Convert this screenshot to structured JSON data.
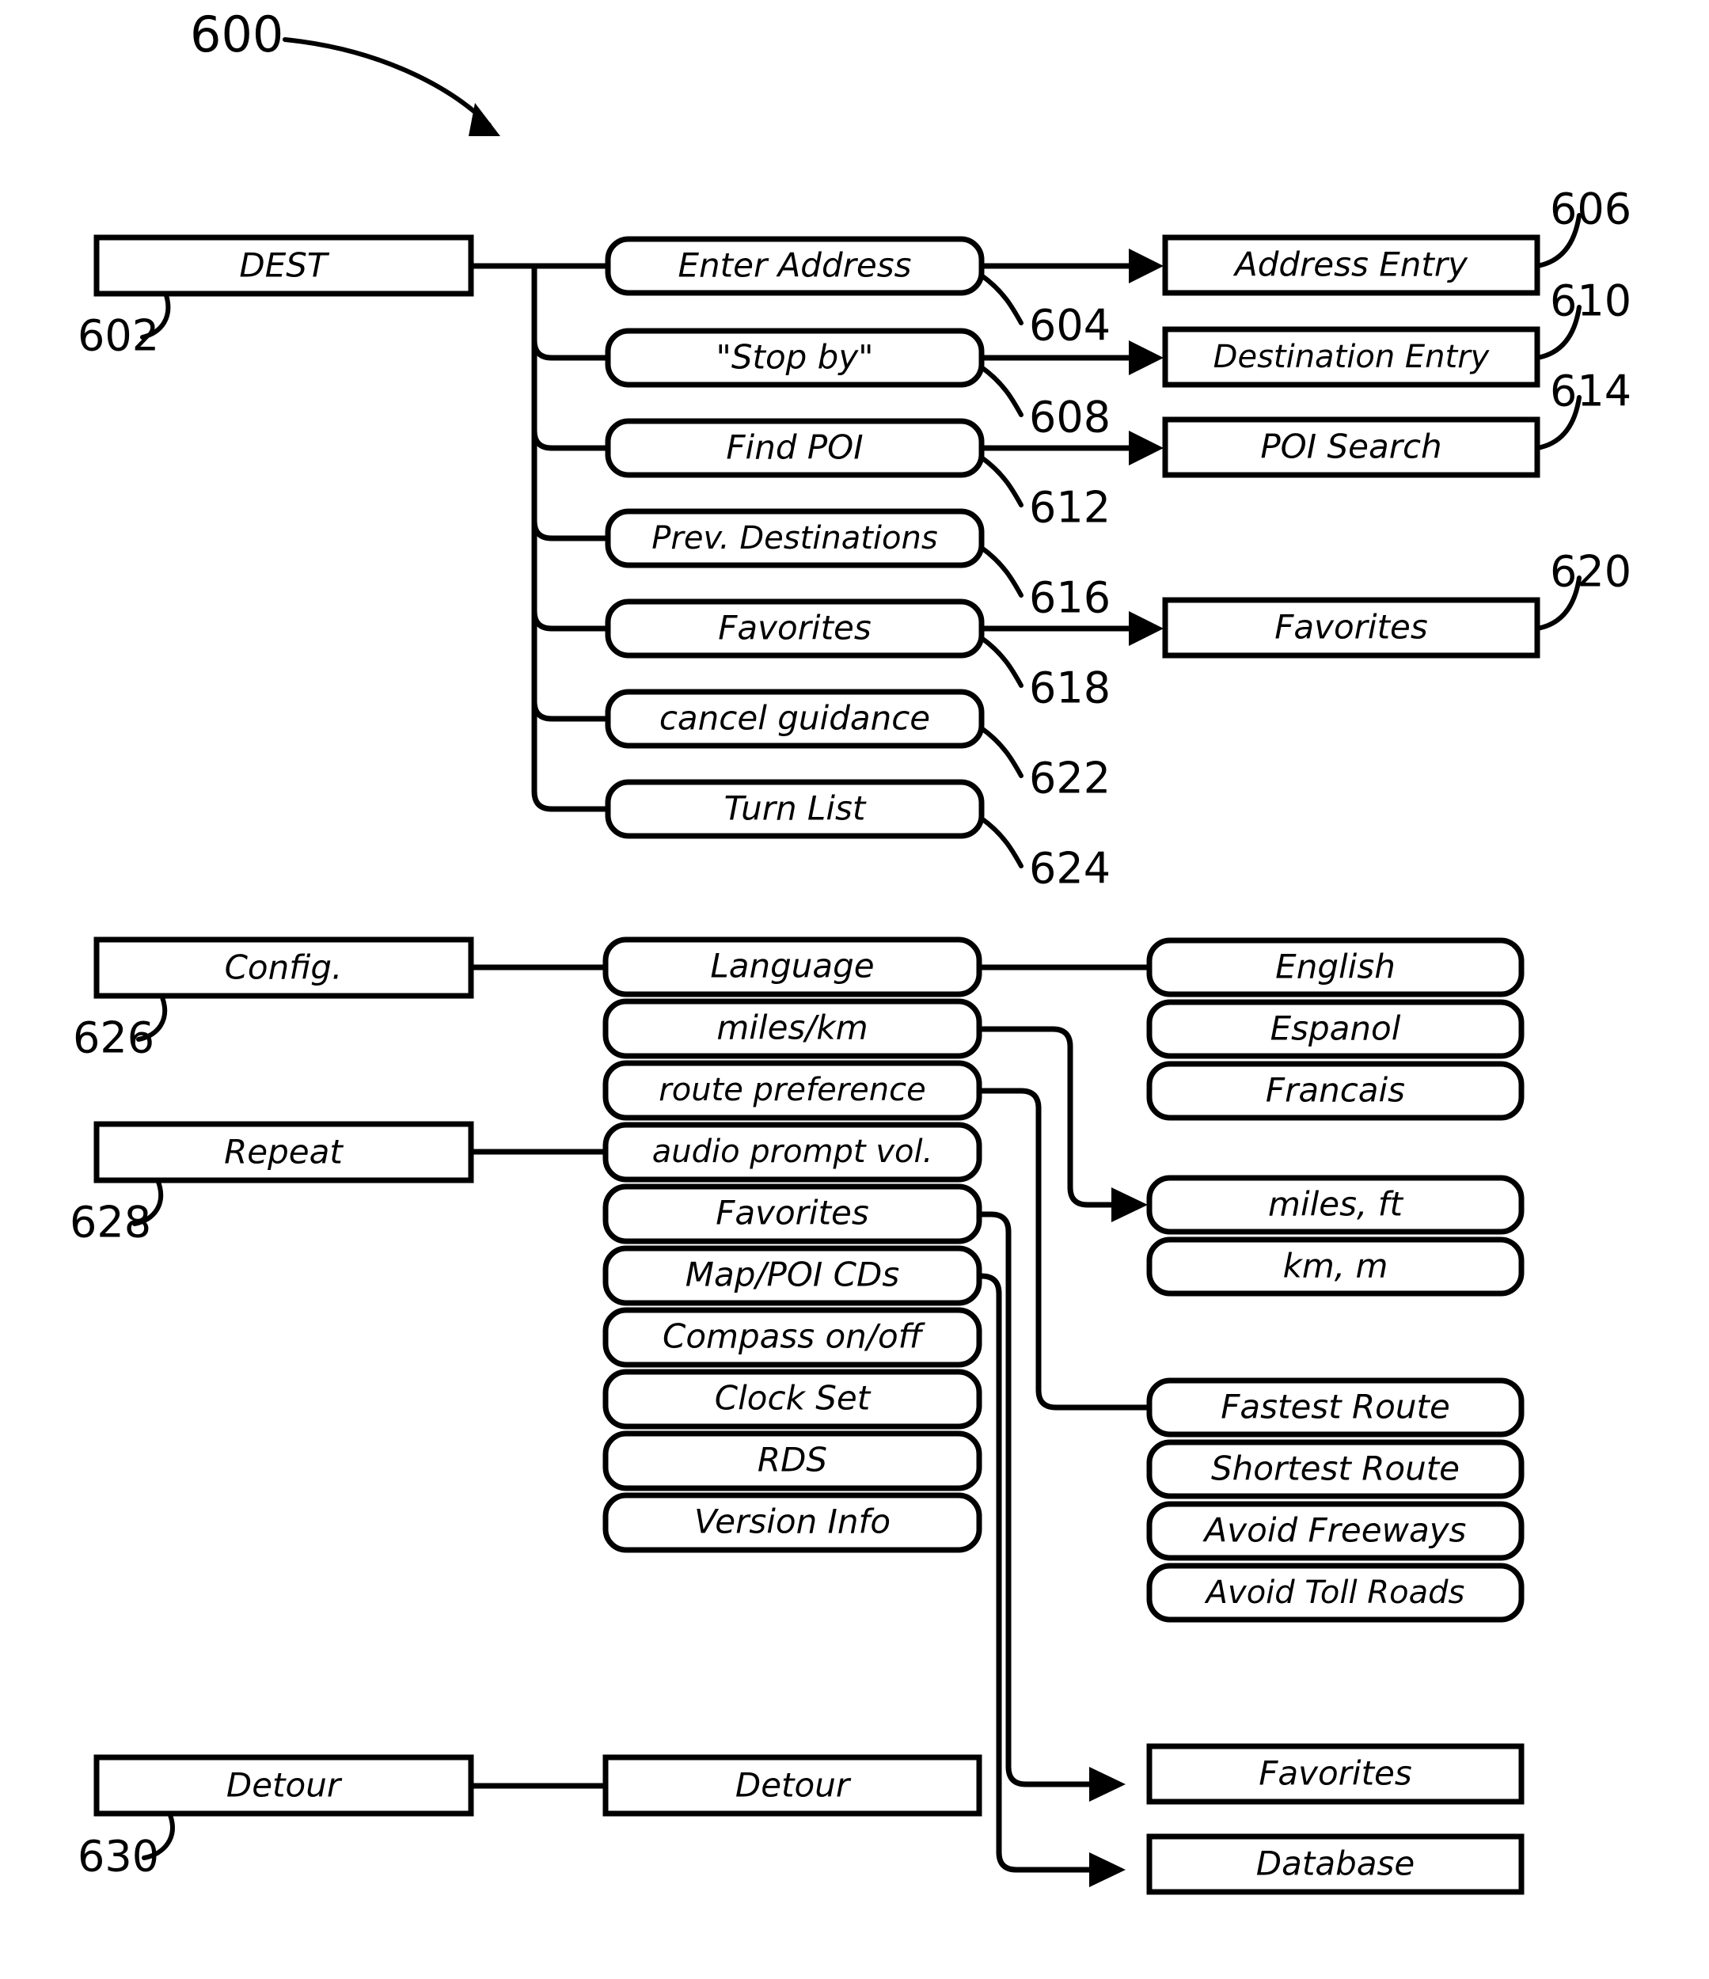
{
  "figure": {
    "number": "600",
    "type": "navigation-system-menu-tree-diagram"
  },
  "dest_section": {
    "root": {
      "label": "DEST",
      "ref": "602"
    },
    "menu_items": [
      {
        "label": "Enter Address",
        "ref": "604"
      },
      {
        "label": "\"Stop by\"",
        "ref": "608"
      },
      {
        "label": "Find POI",
        "ref": "612"
      },
      {
        "label": "Prev. Destinations",
        "ref": "616"
      },
      {
        "label": "Favorites",
        "ref": "618"
      },
      {
        "label": "cancel guidance",
        "ref": "622"
      },
      {
        "label": "Turn List",
        "ref": "624"
      }
    ],
    "screens": [
      {
        "label": "Address Entry",
        "ref": "606"
      },
      {
        "label": "Destination Entry",
        "ref": "610"
      },
      {
        "label": "POI Search",
        "ref": "614"
      },
      {
        "label": "Favorites",
        "ref": "620"
      }
    ]
  },
  "config_section": {
    "roots": [
      {
        "label": "Config.",
        "ref": "626"
      },
      {
        "label": "Repeat",
        "ref": "628"
      }
    ],
    "menu_items": [
      {
        "label": "Language"
      },
      {
        "label": "miles/km"
      },
      {
        "label": "route preference"
      },
      {
        "label": "audio prompt vol."
      },
      {
        "label": "Favorites"
      },
      {
        "label": "Map/POI CDs"
      },
      {
        "label": "Compass on/off"
      },
      {
        "label": "Clock Set"
      },
      {
        "label": "RDS"
      },
      {
        "label": "Version Info"
      }
    ],
    "language_options": [
      {
        "label": "English"
      },
      {
        "label": "Espanol"
      },
      {
        "label": "Francais"
      }
    ],
    "unit_options": [
      {
        "label": "miles, ft"
      },
      {
        "label": "km, m"
      }
    ],
    "route_options": [
      {
        "label": "Fastest Route"
      },
      {
        "label": "Shortest Route"
      },
      {
        "label": "Avoid Freeways"
      },
      {
        "label": "Avoid Toll Roads"
      }
    ]
  },
  "detour_section": {
    "root": {
      "label": "Detour",
      "ref": "630"
    },
    "menu_item": {
      "label": "Detour"
    }
  },
  "bottom_screens": [
    {
      "label": "Favorites"
    },
    {
      "label": "Database"
    }
  ]
}
